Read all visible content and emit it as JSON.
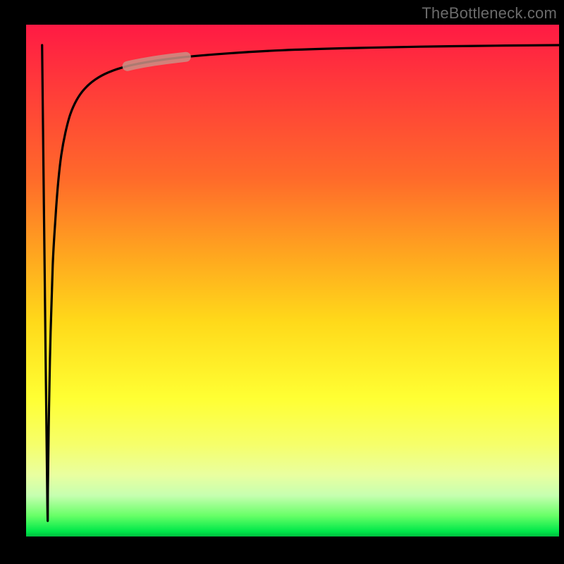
{
  "watermark": "TheBottleneck.com",
  "colors": {
    "background": "#000000",
    "gradient_top": "#ff1a44",
    "gradient_mid": "#ffd91a",
    "gradient_bottom": "#00e84a",
    "curve": "#000000",
    "highlight": "#cb8f85"
  },
  "chart_data": {
    "type": "line",
    "title": "",
    "xlabel": "",
    "ylabel": "",
    "xlim": [
      0,
      100
    ],
    "ylim": [
      0,
      100
    ],
    "series": [
      {
        "name": "curve",
        "x": [
          3.0,
          3.5,
          4.0,
          4.1,
          4.3,
          4.6,
          5.0,
          5.5,
          6.0,
          6.6,
          7.4,
          8.3,
          9.5,
          11,
          13,
          15.5,
          19,
          24,
          30,
          38,
          48,
          60,
          74,
          88,
          100
        ],
        "y": [
          96,
          50,
          6,
          10,
          25,
          40,
          53,
          62,
          69,
          74.5,
          79,
          82.5,
          85.3,
          87.5,
          89.3,
          90.7,
          91.9,
          92.9,
          93.7,
          94.4,
          95.0,
          95.4,
          95.7,
          95.9,
          96.0
        ]
      }
    ],
    "highlight_segment": {
      "x_start": 19,
      "x_end": 30
    }
  }
}
